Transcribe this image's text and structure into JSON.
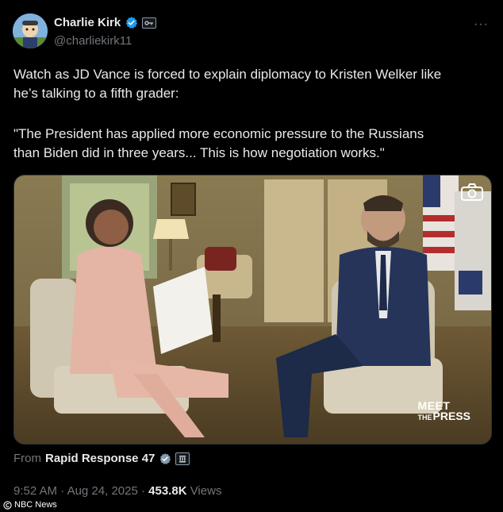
{
  "author": {
    "display_name": "Charlie Kirk",
    "handle": "@charliekirk11",
    "verified_icon": "verified-badge-icon",
    "affiliation_icon": "affiliation-badge-icon"
  },
  "more_icon_glyph": "···",
  "post": {
    "paragraph_1_line_1": "Watch as JD Vance is forced to explain diplomacy to Kristen Welker like",
    "paragraph_1_line_2": "he’s talking to a fifth grader:",
    "paragraph_2_line_1": "\"The President has applied more economic pressure to the Russians",
    "paragraph_2_line_2": "than Biden did in three years... This is how negotiation works.\""
  },
  "media": {
    "watermark_line_1": "MEET",
    "watermark_line_2a": "THE",
    "watermark_line_2b": "PRESS",
    "camera_icon": "camera-icon"
  },
  "source": {
    "from_label": "From",
    "from_name": "Rapid Response 47"
  },
  "meta": {
    "time": "9:52 AM",
    "separator": "·",
    "date": "Aug 24, 2025",
    "views_count": "453.8K",
    "views_label": "Views"
  },
  "credit": {
    "text": "NBC News",
    "icon": "copyright-icon"
  },
  "colors": {
    "background": "#000000",
    "text_primary": "#e7e9ea",
    "text_secondary": "#71767b",
    "verified_blue": "#1d9bf0"
  }
}
